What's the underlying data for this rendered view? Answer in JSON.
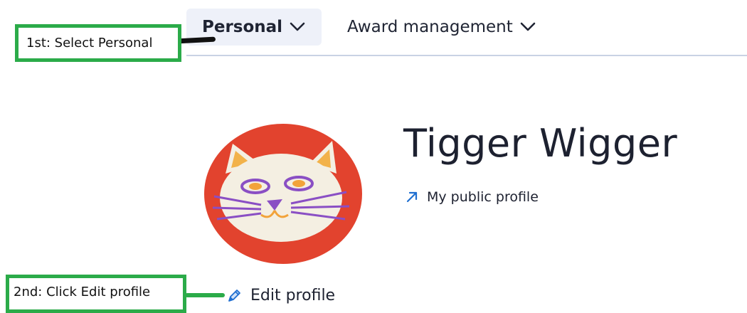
{
  "nav": {
    "tabs": [
      {
        "label": "Personal",
        "active": true
      },
      {
        "label": "Award management",
        "active": false
      }
    ]
  },
  "annotations": [
    {
      "text": "1st: Select Personal"
    },
    {
      "text": "2nd: Click Edit profile"
    }
  ],
  "profile": {
    "name": "Tigger Wigger",
    "public_link_label": "My public profile",
    "public_link_icon": "external-arrow-icon",
    "edit_label": "Edit profile",
    "edit_icon": "pencil-icon"
  },
  "colors": {
    "accent": "#1f6fd1",
    "annotation_border": "#2bab49",
    "active_tab_bg": "#eef1f9",
    "avatar_bg": "#e2432e"
  }
}
